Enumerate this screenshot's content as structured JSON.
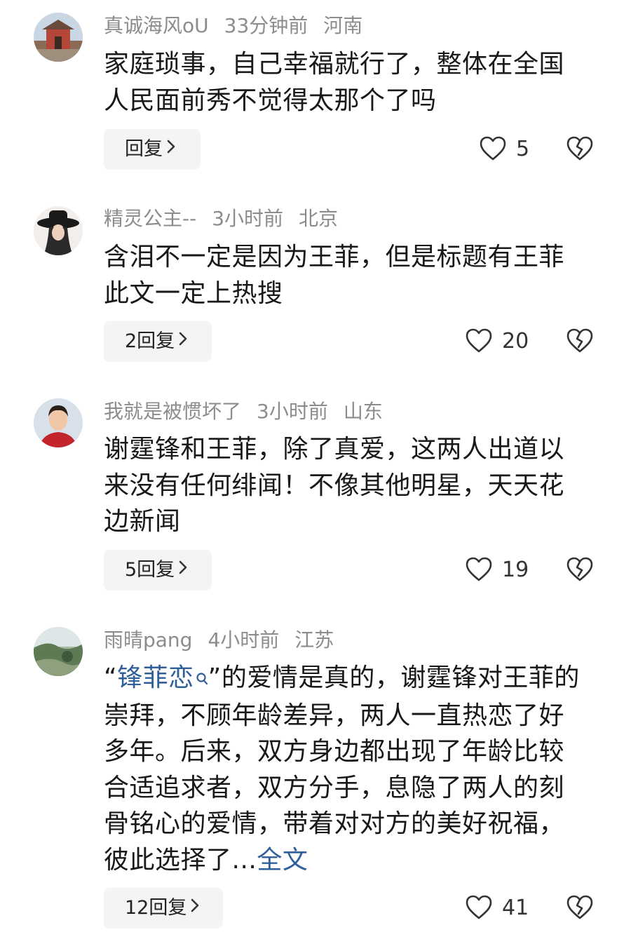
{
  "comments": [
    {
      "username": "真诚海风oU",
      "time": "33分钟前",
      "location": "河南",
      "text": "家庭琐事，自己幸福就行了，整体在全国人民面前秀不觉得太那个了吗",
      "reply_label": "回复",
      "likes": "5",
      "avatar_icon": "temple-avatar-icon"
    },
    {
      "username": "精灵公主--",
      "time": "3小时前",
      "location": "北京",
      "text": "含泪不一定是因为王菲，但是标题有王菲此文一定上热搜",
      "reply_label": "2回复",
      "likes": "20",
      "avatar_icon": "hat-woman-avatar-icon"
    },
    {
      "username": "我就是被惯坏了",
      "time": "3小时前",
      "location": "山东",
      "text": "谢霆锋和王菲，除了真爱，这两人出道以来没有任何绯闻！不像其他明星，天天花边新闻",
      "reply_label": "5回复",
      "likes": "19",
      "avatar_icon": "man-avatar-icon"
    },
    {
      "username": "雨晴pang",
      "time": "4小时前",
      "location": "江苏",
      "text_open_quote": "“",
      "topic": "锋菲恋",
      "text_rest": "”的爱情是真的，谢霆锋对王菲的崇拜，不顾年龄差异，两人一直热恋了好多年。后来，双方身边都出现了年龄比较合适追求者，双方分手，息隐了两人的刻骨铭心的爱情，带着对对方的美好祝福，彼此选择了...",
      "full_text_link": "全文",
      "reply_label": "12回复",
      "likes": "41",
      "avatar_icon": "landscape-avatar-icon"
    }
  ],
  "icons": {
    "like": "heart-outline-icon",
    "dislike": "broken-heart-icon",
    "reply_arrow": "chevron-right-icon",
    "topic_search": "search-icon"
  },
  "colors": {
    "meta_gray": "#8c8c8c",
    "link_blue": "#2f5f9a",
    "reply_bg": "#f4f4f4"
  }
}
